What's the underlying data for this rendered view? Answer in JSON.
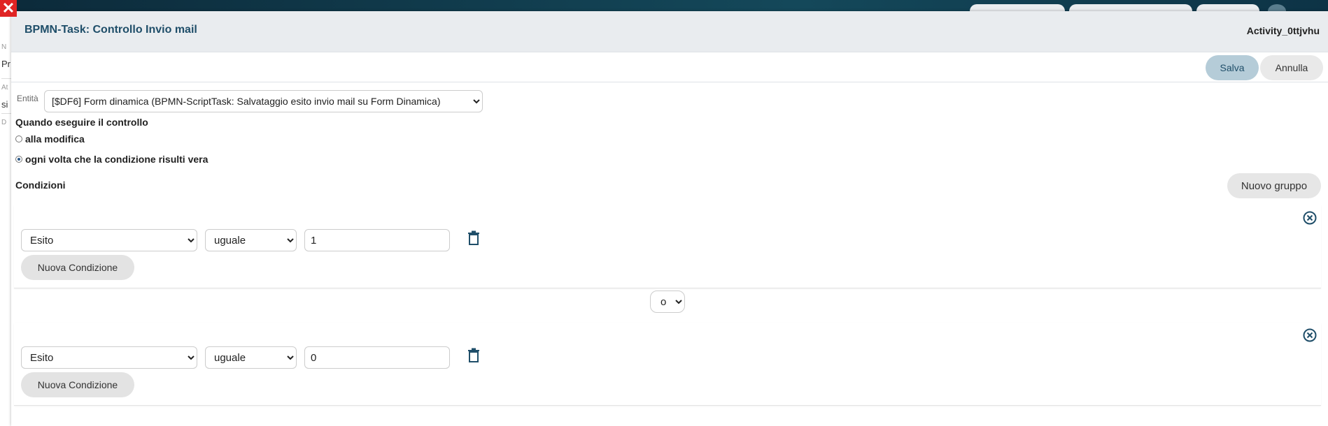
{
  "modal": {
    "title": "BPMN-Task: Controllo Invio mail",
    "activity_id": "Activity_0ttjvhu"
  },
  "toolbar": {
    "save_label": "Salva",
    "cancel_label": "Annulla"
  },
  "background": {
    "fragments": [
      "N",
      "Pr",
      "At",
      "si",
      "D"
    ]
  },
  "entity": {
    "label": "Entità",
    "selected": "[$DF6] Form dinamica (BPMN-ScriptTask: Salvataggio esito invio mail su Form Dinamica)"
  },
  "when": {
    "label": "Quando eseguire il controllo",
    "options": [
      {
        "label": "alla modifica",
        "checked": false
      },
      {
        "label": "ogni volta che la condizione risulti vera",
        "checked": true
      }
    ]
  },
  "conditions": {
    "label": "Condizioni",
    "new_group_label": "Nuovo gruppo",
    "groups": [
      {
        "field": "Esito",
        "operator": "uguale",
        "value": "1",
        "new_condition_label": "Nuova Condizione"
      },
      {
        "field": "Esito",
        "operator": "uguale",
        "value": "0",
        "new_condition_label": "Nuova Condizione"
      }
    ],
    "connector": "o"
  },
  "colors": {
    "accent": "#1f4e69",
    "save_bg": "#b5ccd8",
    "close_red": "#e02424"
  }
}
